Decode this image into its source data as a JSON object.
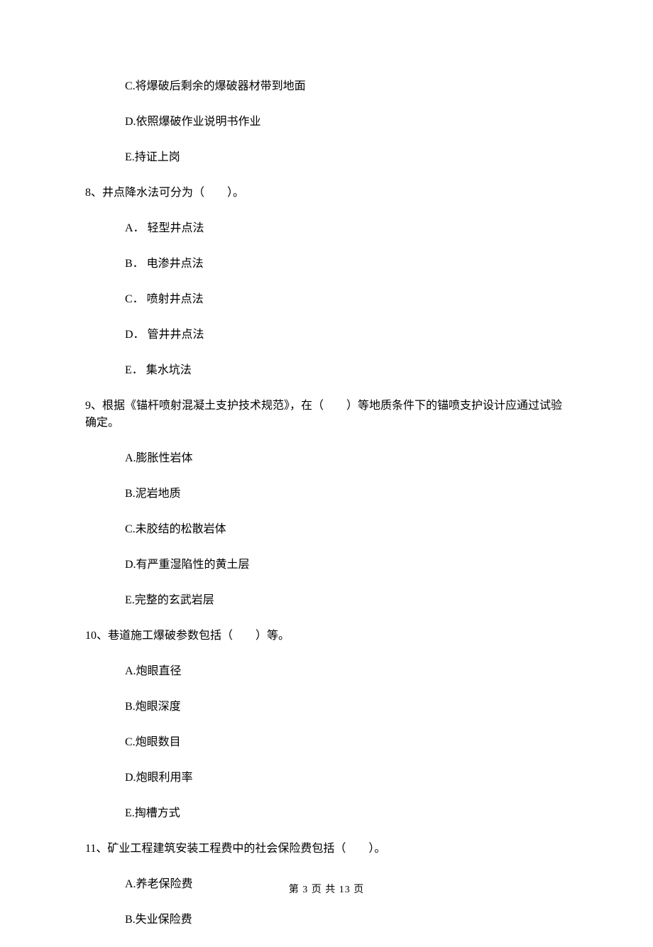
{
  "items": {
    "i0": "C.将爆破后剩余的爆破器材带到地面",
    "i1": "D.依照爆破作业说明书作业",
    "i2": "E.持证上岗",
    "i3": "8、井点降水法可分为（　　）。",
    "i4": "A． 轻型井点法",
    "i5": "B． 电渗井点法",
    "i6": "C． 喷射井点法",
    "i7": "D． 管井井点法",
    "i8": "E． 集水坑法",
    "i9": "9、根据《锚杆喷射混凝土支护技术规范》，在（　　）等地质条件下的锚喷支护设计应通过试验确定。",
    "i10": "A.膨胀性岩体",
    "i11": "B.泥岩地质",
    "i12": "C.未胶结的松散岩体",
    "i13": "D.有严重湿陷性的黄土层",
    "i14": "E.完整的玄武岩层",
    "i15": "10、巷道施工爆破参数包括（　　）等。",
    "i16": "A.炮眼直径",
    "i17": "B.炮眼深度",
    "i18": "C.炮眼数目",
    "i19": "D.炮眼利用率",
    "i20": "E.掏槽方式",
    "i21": "11、矿业工程建筑安装工程费中的社会保险费包括（　　）。",
    "i22": "A.养老保险费",
    "i23": "B.失业保险费"
  },
  "footer": "第 3 页 共 13 页"
}
